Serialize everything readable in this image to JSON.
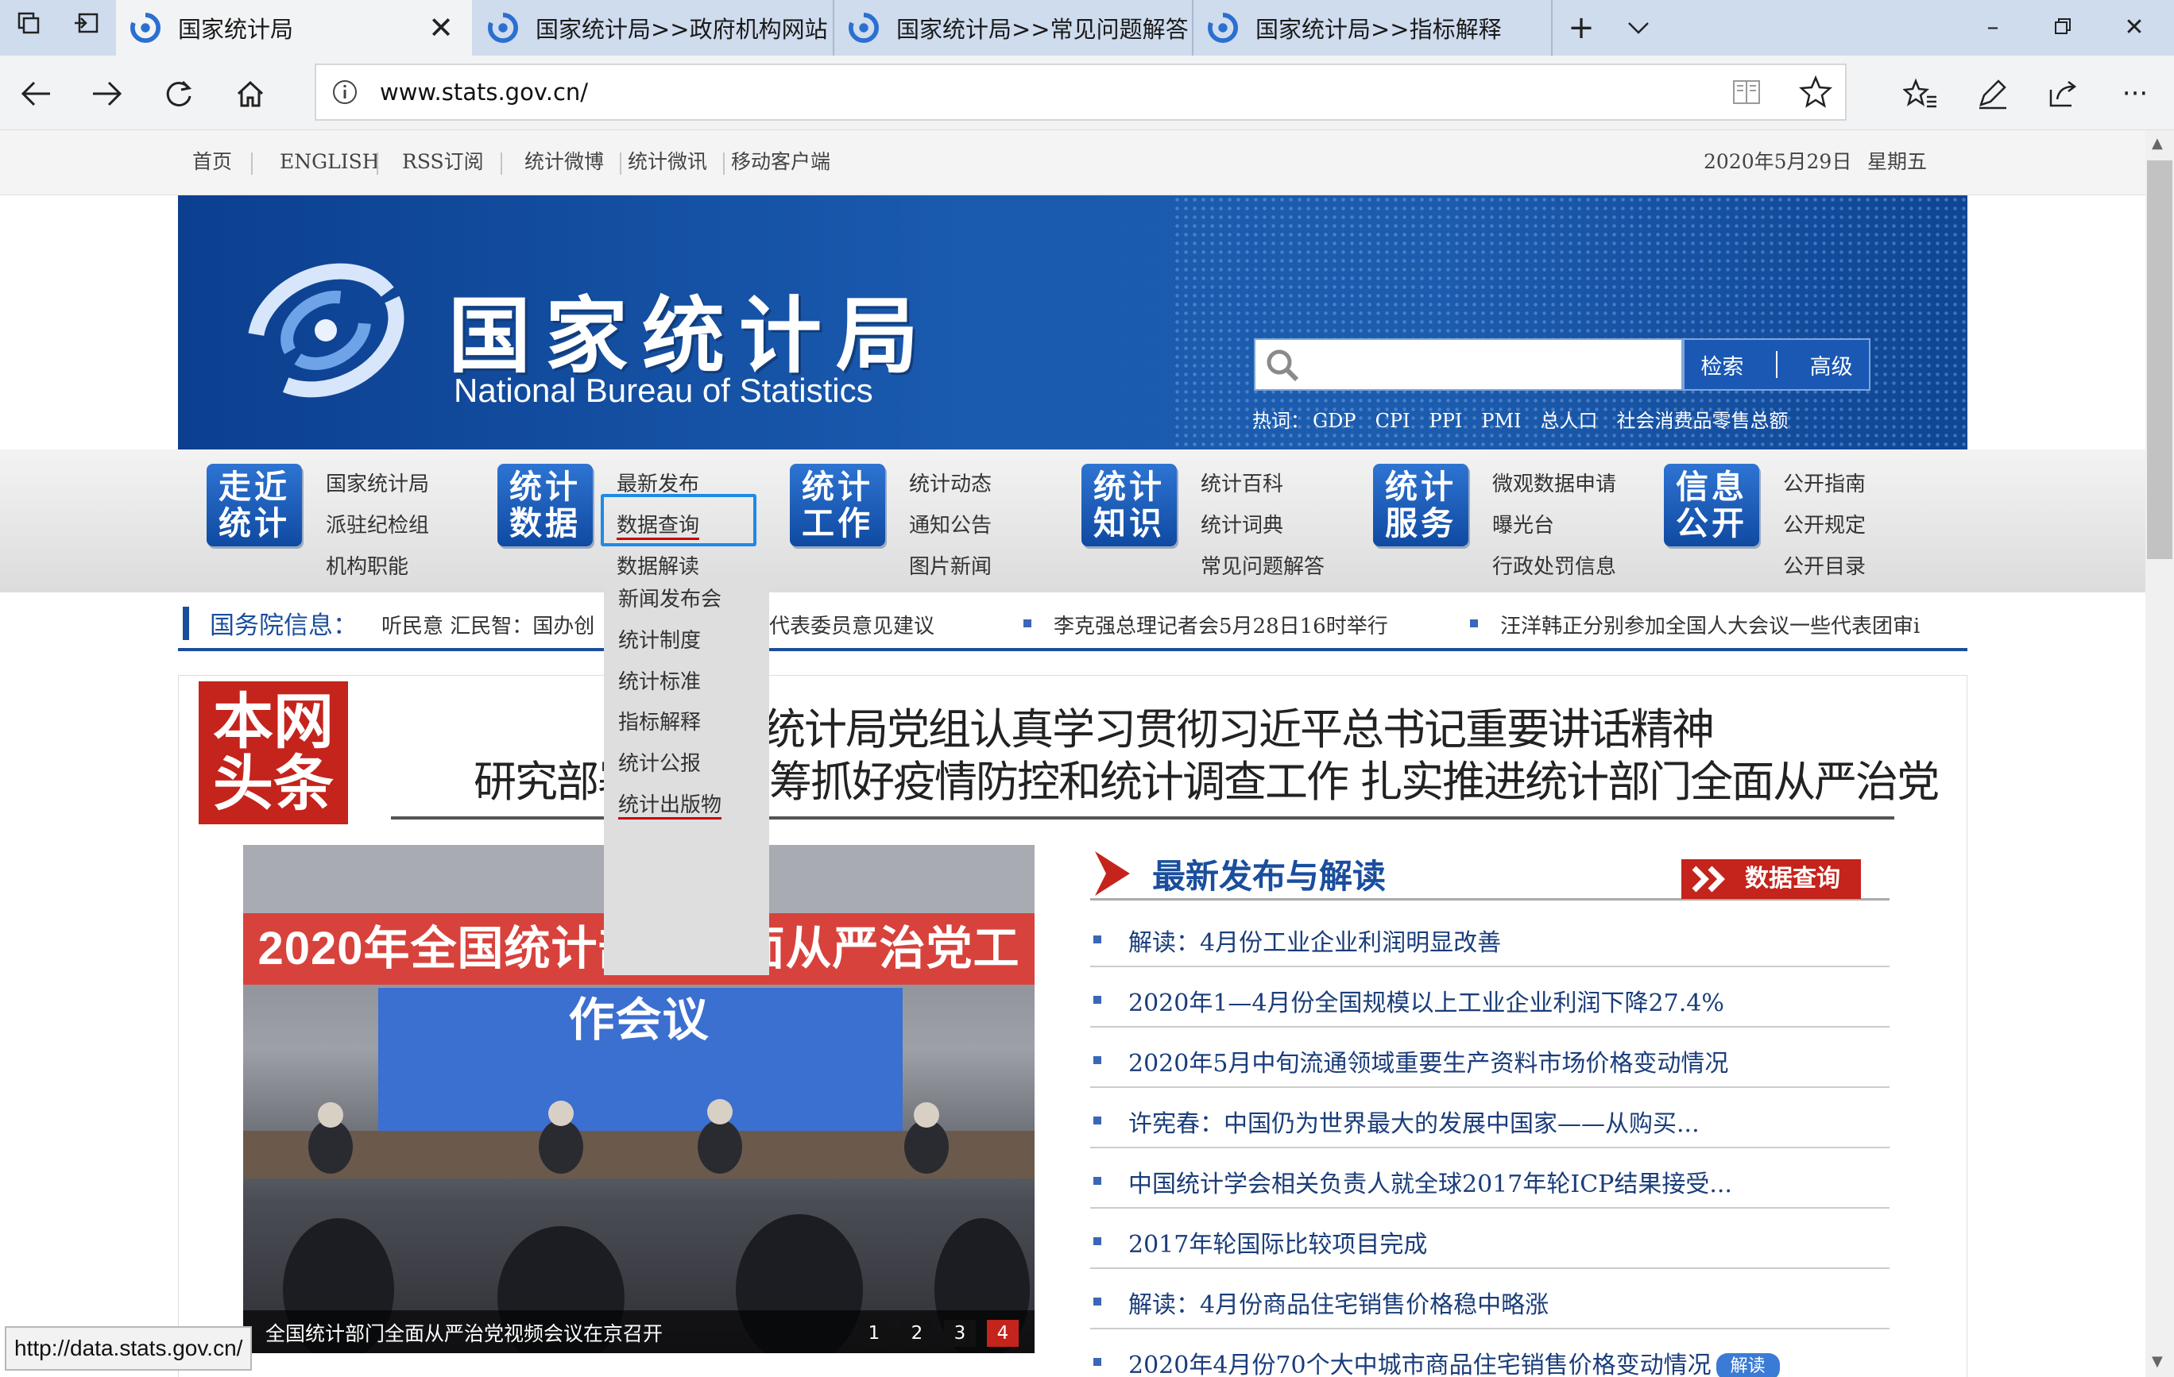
{
  "browser": {
    "tabs": [
      {
        "title": "国家统计局",
        "active": true
      },
      {
        "title": "国家统计局>>政府机构网站",
        "active": false
      },
      {
        "title": "国家统计局>>常见问题解答",
        "active": false
      },
      {
        "title": "国家统计局>>指标解释",
        "active": false
      }
    ],
    "address": "www.stats.gov.cn/",
    "status_url": "http://data.stats.gov.cn/"
  },
  "topbar": {
    "links": [
      "首页",
      "ENGLISH",
      "RSS订阅",
      "统计微博",
      "统计微讯",
      "移动客户端"
    ],
    "date": "2020年5月29日",
    "weekday": "星期五"
  },
  "header": {
    "title": "国家统计局",
    "subtitle": "National Bureau of Statistics",
    "search_button": "检索",
    "advanced_button": "高级",
    "hotwords_label": "热词：",
    "hotwords": [
      "GDP",
      "CPI",
      "PPI",
      "PMI",
      "总人口",
      "社会消费品零售总额"
    ]
  },
  "menu": [
    {
      "badge": [
        "走近",
        "统计"
      ],
      "links": [
        "国家统计局",
        "派驻纪检组",
        "机构职能"
      ]
    },
    {
      "badge": [
        "统计",
        "数据"
      ],
      "links": [
        "最新发布",
        "数据查询",
        "数据解读"
      ]
    },
    {
      "badge": [
        "统计",
        "工作"
      ],
      "links": [
        "统计动态",
        "通知公告",
        "图片新闻"
      ]
    },
    {
      "badge": [
        "统计",
        "知识"
      ],
      "links": [
        "统计百科",
        "统计词典",
        "常见问题解答"
      ]
    },
    {
      "badge": [
        "统计",
        "服务"
      ],
      "links": [
        "微观数据申请",
        "曝光台",
        "行政处罚信息"
      ]
    },
    {
      "badge": [
        "信息",
        "公开"
      ],
      "links": [
        "公开指南",
        "公开规定",
        "公开目录"
      ]
    }
  ],
  "dropdown": [
    "新闻发布会",
    "统计制度",
    "统计标准",
    "指标解释",
    "统计公报",
    "统计出版物"
  ],
  "ticker": {
    "label": "国务院信息：",
    "items": [
      "听民意 汇民智：国办创",
      "代表委员意见建议",
      "李克强总理记者会5月28日16时举行",
      "汪洋韩正分别参加全国人大会议一些代表团审i"
    ]
  },
  "headline": {
    "badge": [
      "本网",
      "头条"
    ],
    "line1": "统计局党组认真学习贯彻习近平总书记重要讲话精神",
    "line2_left": "研究部署",
    "line2_right": "筹抓好疫情防控和统计调查工作 扎实推进统计部门全面从严治党"
  },
  "photo": {
    "banner_text": "2020年全国统计部门全面从严治党工作会议",
    "caption": "全国统计部门全面从严治党视频会议在京召开",
    "pages": [
      "1",
      "2",
      "3",
      "4"
    ],
    "active_page": "4"
  },
  "news": {
    "title": "最新发布与解读",
    "query_button": "数据查询",
    "items": [
      "解读：4月份工业企业利润明显改善",
      "2020年1—4月份全国规模以上工业企业利润下降27.4%",
      "2020年5月中旬流通领域重要生产资料市场价格变动情况",
      "许宪春：中国仍为世界最大的发展中国家——从购买...",
      "中国统计学会相关负责人就全球2017年轮ICP结果接受...",
      "2017年轮国际比较项目完成",
      "解读：4月份商品住宅销售价格稳中略涨",
      "2020年4月份70个大中城市商品住宅销售价格变动情况"
    ],
    "last_tag": "解读"
  },
  "colors": {
    "brand_blue": "#1a4e9d",
    "brand_red": "#c4241c",
    "tab_bar": "#cfdcee"
  }
}
